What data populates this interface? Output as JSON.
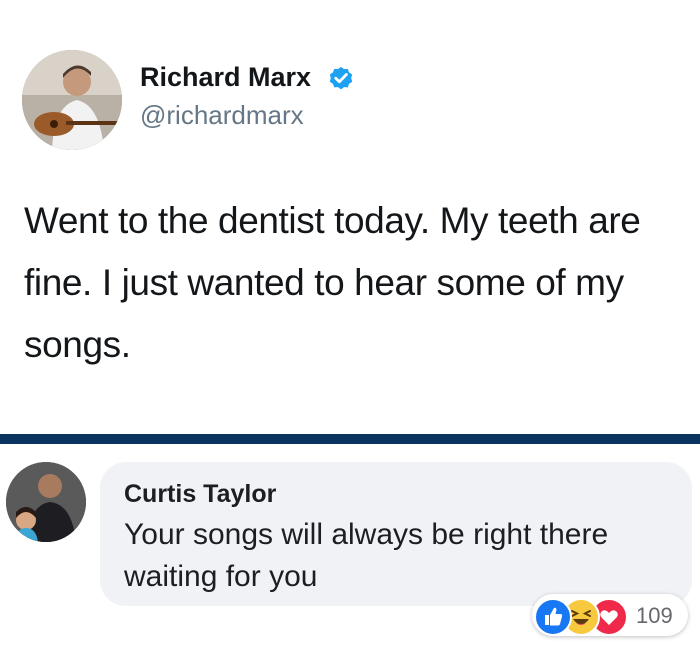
{
  "tweet": {
    "author_name": "Richard Marx",
    "handle": "@richardmarx",
    "text": "Went to the dentist today. My teeth are fine. I just wanted to hear some of my songs.",
    "verified_icon": "verified-badge-icon",
    "accent_color": "#1da1f2"
  },
  "divider_color": "#0a3360",
  "comment": {
    "commenter_name": "Curtis Taylor",
    "text": "Your songs will always be right there waiting for you",
    "reactions": {
      "icons": [
        "like-icon",
        "haha-icon",
        "love-icon"
      ],
      "count": "109"
    }
  }
}
